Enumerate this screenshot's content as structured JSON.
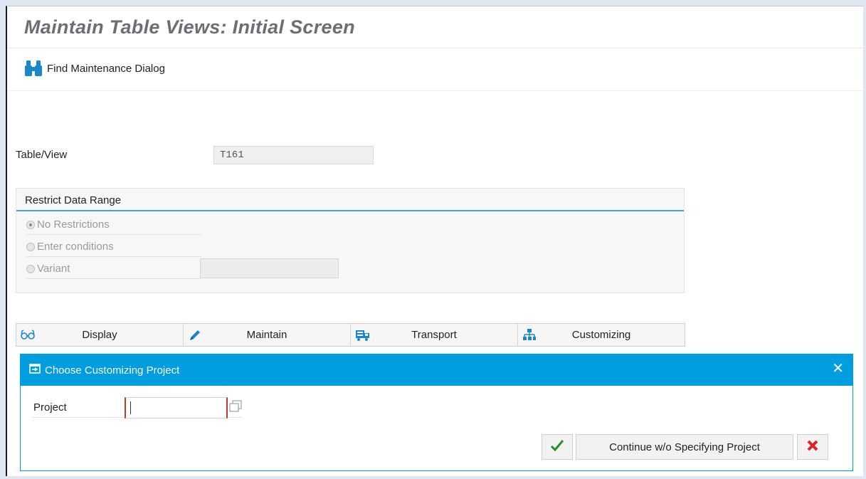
{
  "screen": {
    "title": "Maintain Table Views: Initial Screen"
  },
  "toolbar": {
    "find_label": "Find Maintenance Dialog"
  },
  "form": {
    "table_view_label": "Table/View",
    "table_view_value": "T161"
  },
  "restrict": {
    "title": "Restrict Data Range",
    "options": [
      "No Restrictions",
      "Enter conditions",
      "Variant"
    ],
    "selected": "No Restrictions",
    "variant_value": ""
  },
  "actions": {
    "display": "Display",
    "maintain": "Maintain",
    "transport": "Transport",
    "customizing": "Customizing"
  },
  "dialog": {
    "title": "Choose Customizing Project",
    "project_label": "Project",
    "project_value": "",
    "continue_label": "Continue w/o Specifying Project"
  },
  "colors": {
    "accent": "#009de0",
    "confirm_green": "#2e8b2e",
    "cancel_red": "#d9232e"
  }
}
